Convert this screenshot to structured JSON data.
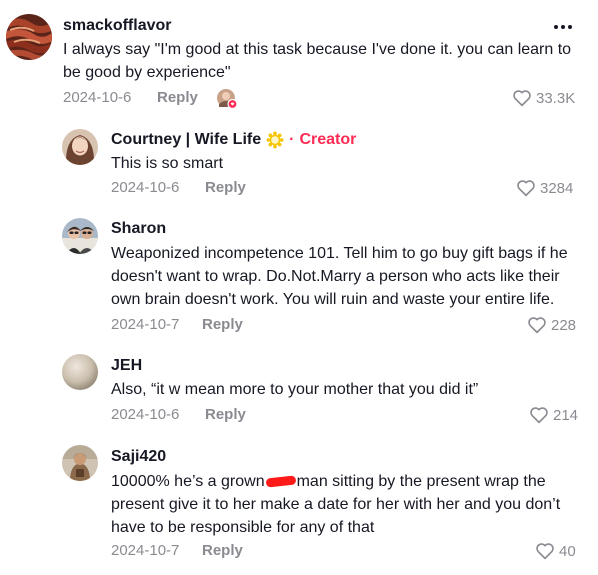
{
  "comments": [
    {
      "username": "smackofflavor",
      "text": "I always say \"I'm good at this task because I've done it. you can learn to be good by experience\"",
      "date": "2024-10-6",
      "reply": "Reply",
      "likes": "33.3K"
    }
  ],
  "replies": [
    {
      "username": "Courtney | Wife Life",
      "creator_label": "Creator",
      "text": "This is so smart",
      "date": "2024-10-6",
      "reply": "Reply",
      "likes": "3284"
    },
    {
      "username": "Sharon",
      "text": "Weaponized incompetence 101. Tell him to go buy gift bags if he doesn't want to wrap. Do.Not.Marry a person who acts like their own brain doesn't work. You will ruin and waste your entire life.",
      "date": "2024-10-7",
      "reply": "Reply",
      "likes": "228"
    },
    {
      "username": "JEH",
      "text": "Also, “it w mean more to your mother that you did it”",
      "date": "2024-10-6",
      "reply": "Reply",
      "likes": "214"
    },
    {
      "username": "Saji420",
      "text_before": "10000% he’s a grown",
      "text_after": "man sitting by the present wrap the present give it to her make a date for her with her and you don’t have to be responsible for any of that",
      "date": "2024-10-7",
      "reply": "Reply",
      "likes": "40"
    }
  ],
  "colors": {
    "accent": "#fe2c55",
    "meta": "#8a8b91",
    "text": "#161823"
  },
  "icons": [
    "more-icon",
    "heart-icon",
    "creator-badge-icon"
  ]
}
